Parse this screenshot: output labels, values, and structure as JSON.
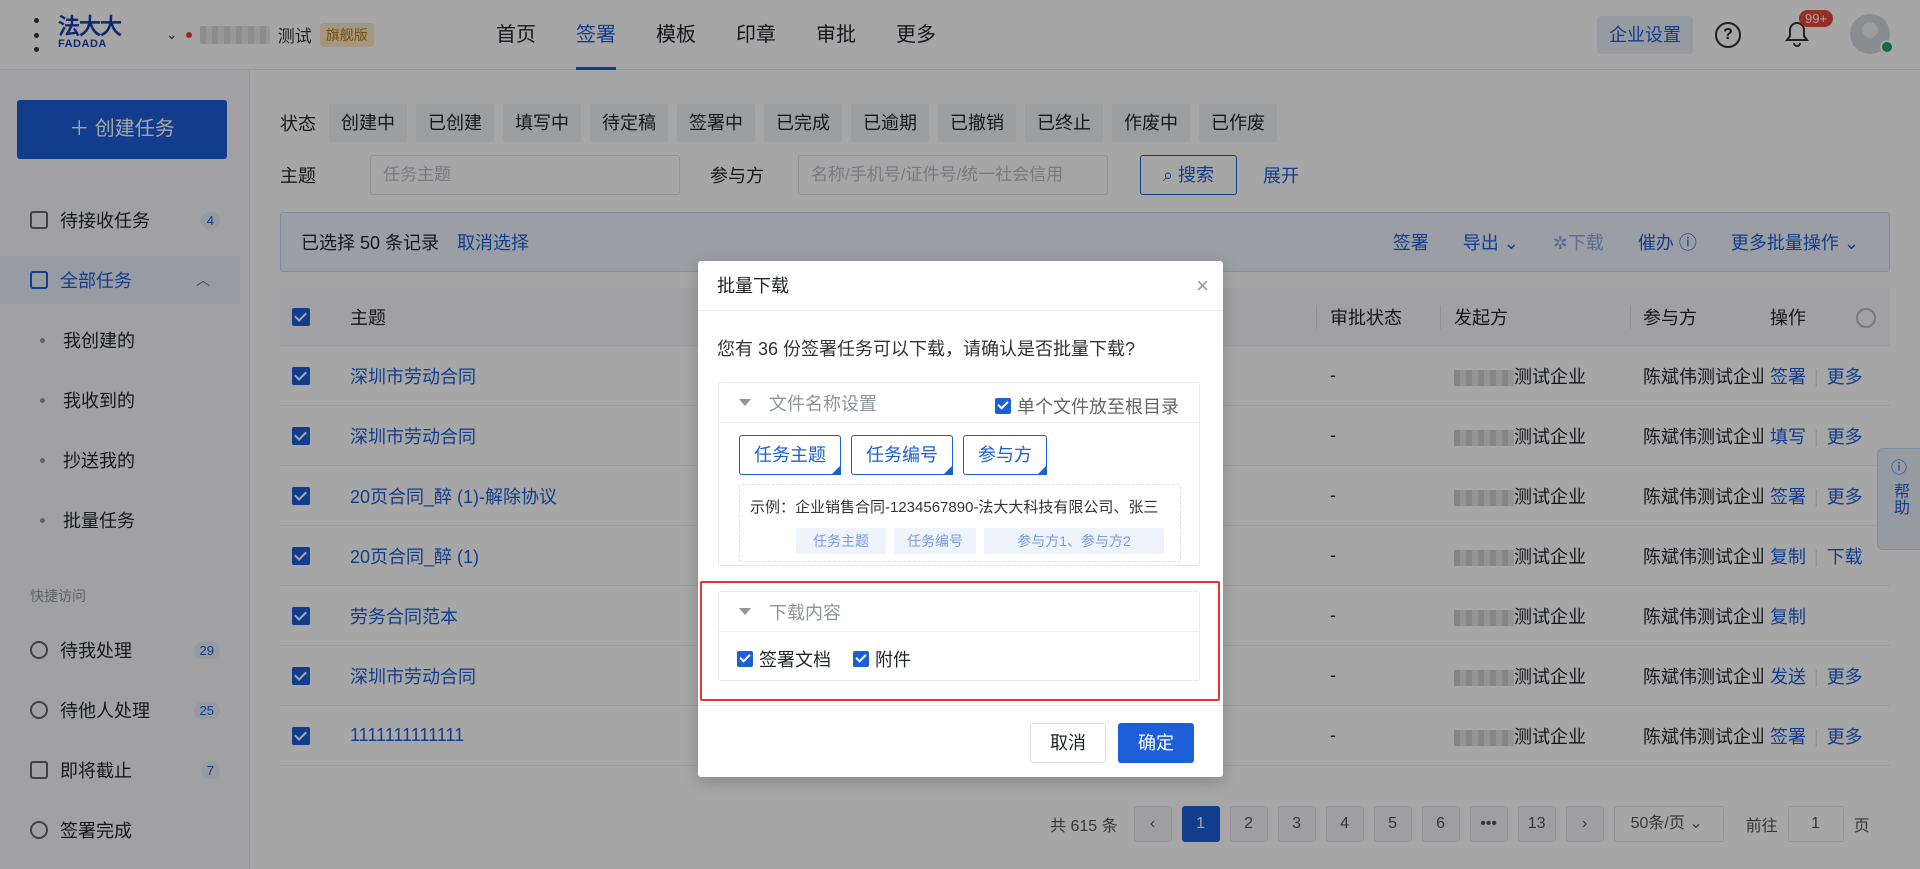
{
  "header": {
    "logo_cn": "法大大",
    "logo_en": "FADADA",
    "enterprise_name": "测试",
    "edition_badge": "旗舰版",
    "nav": [
      "首页",
      "签署",
      "模板",
      "印章",
      "审批",
      "更多"
    ],
    "active_nav": "签署",
    "enterprise_settings": "企业设置",
    "help": "?",
    "notification_count": "99+"
  },
  "sidebar": {
    "create_button": "创建任务",
    "items": [
      {
        "label": "待接收任务",
        "count": "4"
      },
      {
        "label": "全部任务"
      }
    ],
    "sub_items": [
      "我创建的",
      "我收到的",
      "抄送我的",
      "批量任务"
    ],
    "quick_title": "快捷访问",
    "quick_items": [
      {
        "label": "待我处理",
        "count": "29"
      },
      {
        "label": "待他人处理",
        "count": "25"
      },
      {
        "label": "即将截止",
        "count": "7"
      },
      {
        "label": "签署完成"
      }
    ]
  },
  "filters": {
    "status_label": "状态",
    "statuses": [
      "创建中",
      "已创建",
      "填写中",
      "待定稿",
      "签署中",
      "已完成",
      "已逾期",
      "已撤销",
      "已终止",
      "作废中",
      "已作废"
    ],
    "subject_label": "主题",
    "subject_placeholder": "任务主题",
    "participant_label": "参与方",
    "participant_placeholder": "名称/手机号/证件号/统一社会信用",
    "search_button": "搜索",
    "expand_link": "展开"
  },
  "selection_bar": {
    "selected_text": "已选择 50 条记录",
    "cancel_select": "取消选择",
    "actions": [
      "签署",
      "导出",
      "下载",
      "催办",
      "更多批量操作"
    ]
  },
  "table": {
    "headers": [
      "主题",
      "审批状态",
      "发起方",
      "参与方",
      "操作"
    ],
    "rows": [
      {
        "subject": "深圳市劳动合同",
        "approval": "-",
        "initiator": "测试企业",
        "participant": "陈斌伟测试企业",
        "ops": [
          "签署",
          "更多"
        ]
      },
      {
        "subject": "深圳市劳动合同",
        "approval": "-",
        "initiator": "测试企业",
        "participant": "陈斌伟测试企业",
        "ops": [
          "填写",
          "更多"
        ]
      },
      {
        "subject": "20页合同_醉 (1)-解除协议",
        "approval": "-",
        "initiator": "测试企业",
        "participant": "陈斌伟测试企业",
        "ops": [
          "签署",
          "更多"
        ]
      },
      {
        "subject": "20页合同_醉 (1)",
        "approval": "-",
        "initiator": "测试企业",
        "participant": "陈斌伟测试企业",
        "ops": [
          "复制",
          "下载"
        ]
      },
      {
        "subject": "劳务合同范本",
        "approval": "-",
        "initiator": "测试企业",
        "participant": "陈斌伟测试企业",
        "ops": [
          "复制"
        ]
      },
      {
        "subject": "深圳市劳动合同",
        "approval": "-",
        "initiator": "测试企业",
        "participant": "陈斌伟测试企业",
        "ops": [
          "发送",
          "更多"
        ]
      },
      {
        "subject": "1111111111111",
        "approval": "-",
        "initiator": "测试企业",
        "participant": "陈斌伟测试企业",
        "ops": [
          "签署",
          "更多"
        ]
      }
    ]
  },
  "pagination": {
    "total": "共 615 条",
    "pages": [
      "1",
      "2",
      "3",
      "4",
      "5",
      "6",
      "•••",
      "13"
    ],
    "current": "1",
    "page_size": "50条/页",
    "goto_label": "前往",
    "goto_value": "1",
    "page_unit": "页"
  },
  "help_float": "帮助",
  "modal": {
    "title": "批量下载",
    "message": "您有 36 份签署任务可以下载，请确认是否批量下载?",
    "filename_section": "文件名称设置",
    "root_option": "单个文件放至根目录",
    "name_tags": [
      "任务主题",
      "任务编号",
      "参与方"
    ],
    "example_text": "示例：企业销售合同-1234567890-法大大科技有限公司、张三",
    "example_labels": [
      "任务主题",
      "任务编号",
      "参与方1、参与方2"
    ],
    "download_section": "下载内容",
    "download_options": [
      "签署文档",
      "附件"
    ],
    "cancel": "取消",
    "confirm": "确定"
  }
}
